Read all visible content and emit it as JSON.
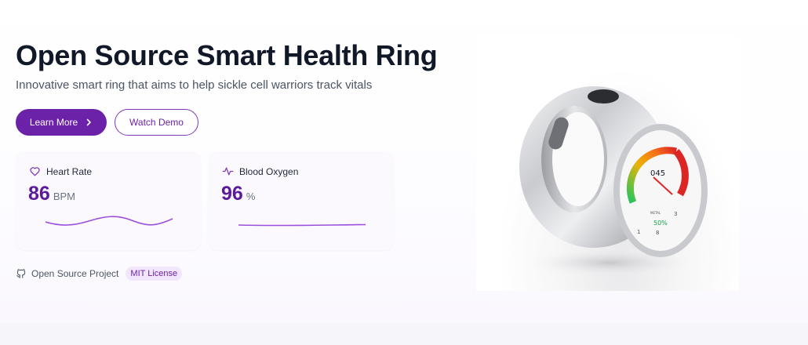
{
  "hero": {
    "title": "Open Source Smart Health Ring",
    "subtitle": "Innovative smart ring that aims to help sickle cell warriors track vitals"
  },
  "actions": {
    "learn_more": "Learn More",
    "watch_demo": "Watch Demo"
  },
  "metrics": {
    "heart_rate": {
      "label": "Heart Rate",
      "value": "86",
      "unit": "BPM",
      "icon": "heart-icon"
    },
    "blood_oxygen": {
      "label": "Blood Oxygen",
      "value": "96",
      "unit": "%",
      "icon": "activity-icon"
    }
  },
  "footer": {
    "project_label": "Open Source Project",
    "license_badge": "MIT License",
    "icon": "github-icon"
  },
  "ring_display": {
    "reading": "045",
    "small_label": "METAL",
    "percent": "50%",
    "left_digit": "1",
    "mid_digit": "8",
    "right_digit": "3"
  },
  "colors": {
    "primary": "#6b21a8",
    "value_text": "#5b1a9a",
    "sparkline": "#9d4edd",
    "badge_bg": "#f1e6fb"
  }
}
